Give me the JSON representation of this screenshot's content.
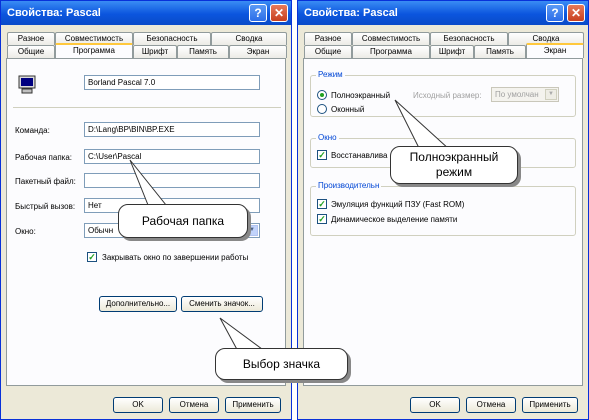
{
  "left": {
    "title": "Свойства: Pascal",
    "tabs_row1": [
      "Разное",
      "Совместимость",
      "Безопасность",
      "Сводка"
    ],
    "tabs_row2": [
      "Общие",
      "Программа",
      "Шрифт",
      "Память",
      "Экран"
    ],
    "program_name": "Borland Pascal 7.0",
    "command_label": "Команда:",
    "command_value": "D:\\Lang\\BP\\BIN\\BP.EXE",
    "workdir_label": "Рабочая папка:",
    "workdir_value": "C:\\User\\Pascal",
    "batch_label": "Пакетный файл:",
    "batch_value": "",
    "hotkey_label": "Быстрый вызов:",
    "hotkey_value": "Нет",
    "window_label": "Окно:",
    "window_value": "Обычн",
    "close_on_exit": "Закрывать окно по завершении работы",
    "advanced_button": "Дополнительно...",
    "change_icon_button": "Сменить значок...",
    "ok": "OK",
    "cancel": "Отмена",
    "apply": "Применить"
  },
  "right": {
    "title": "Свойства: Pascal",
    "tabs_row1": [
      "Разное",
      "Совместимость",
      "Безопасность",
      "Сводка"
    ],
    "tabs_row2": [
      "Общие",
      "Программа",
      "Шрифт",
      "Память",
      "Экран"
    ],
    "mode_group": "Режим",
    "fullscreen": "Полноэкранный",
    "windowed": "Оконный",
    "initial_size_label": "Исходный размер:",
    "initial_size_value": "По умолчан",
    "window_group": "Окно",
    "restore_label": "Восстанавлива",
    "perf_group": "Производительн",
    "rom_emulation": "Эмуляция функций ПЗУ (Fast ROM)",
    "dynamic_memory": "Динамическое выделение памяти",
    "ok": "OK",
    "cancel": "Отмена",
    "apply": "Применить"
  },
  "callouts": {
    "workdir": "Рабочая папка",
    "icon": "Выбор значка",
    "fullscreen_line1": "Полноэкранный",
    "fullscreen_line2": "режим"
  }
}
